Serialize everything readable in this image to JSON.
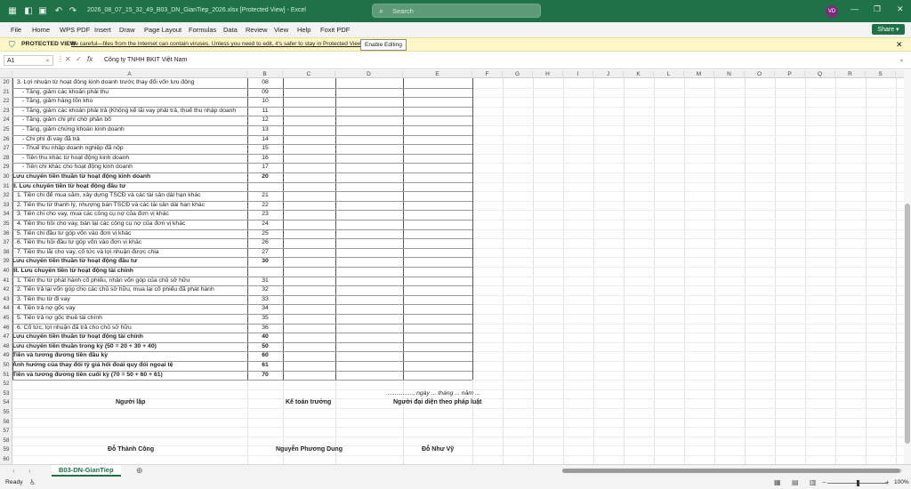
{
  "titlebar": {
    "autosave_icon": "autosave-icon",
    "save_icon": "save-icon",
    "undo_icon": "undo-icon",
    "redo_icon": "redo-icon",
    "title": "2026_08_07_15_32_49_B03_DN_GianTiep_2026.xlsx  [Protected View]  -  Excel",
    "search_placeholder": "Search",
    "avatar_initials": "VD",
    "accent_color": "#1f7246"
  },
  "ribbon": {
    "tabs": [
      "File",
      "Home",
      "WPS PDF",
      "Insert",
      "Draw",
      "Page Layout",
      "Formulas",
      "Data",
      "Review",
      "View",
      "Help",
      "Foxit PDF"
    ],
    "share_label": "Share"
  },
  "protected_view": {
    "label": "PROTECTED VIEW",
    "message": "Be careful—files from the Internet can contain viruses. Unless you need to edit, it's safer to stay in Protected View.",
    "enable_button": "Enable Editing"
  },
  "formula_bar": {
    "name_box": "A1",
    "fx_label": "fx",
    "value": "Công ty TNHH BKIT Việt Nam"
  },
  "columns": [
    "A",
    "B",
    "C",
    "D",
    "E",
    "F",
    "G",
    "H",
    "I",
    "J",
    "K",
    "L",
    "M",
    "N",
    "O",
    "P",
    "Q",
    "R",
    "S"
  ],
  "rows": [
    {
      "n": "20",
      "a": "   3. Lợi nhuận từ hoạt động kinh doanh trước thay đổi vốn lưu động",
      "b": "08",
      "style": "ind1"
    },
    {
      "n": "21",
      "a": "- Tăng, giảm các khoản phải thu",
      "b": "09",
      "style": "ind2"
    },
    {
      "n": "22",
      "a": "- Tăng, giảm hàng tồn kho",
      "b": "10",
      "style": "ind2"
    },
    {
      "n": "23",
      "a": "- Tăng, giảm các khoản phải trả (Không kể lãi vay phải trả, thuế thu nhập doanh",
      "b": "11",
      "style": "ind2"
    },
    {
      "n": "24",
      "a": "- Tăng, giảm chi phí chờ phân bổ",
      "b": "12",
      "style": "ind2"
    },
    {
      "n": "25",
      "a": "- Tăng, giảm chứng khoán kinh doanh",
      "b": "13",
      "style": "ind2"
    },
    {
      "n": "26",
      "a": "- Chi phí đi vay đã trả",
      "b": "14",
      "style": "ind2"
    },
    {
      "n": "27",
      "a": "- Thuế thu nhập doanh nghiệp đã nộp",
      "b": "15",
      "style": "ind2"
    },
    {
      "n": "28",
      "a": "- Tiền thu khác từ hoạt động kinh doanh",
      "b": "16",
      "style": "ind2"
    },
    {
      "n": "29",
      "a": "- Tiền chi khác cho hoạt động kinh doanh",
      "b": "17",
      "style": "ind2"
    },
    {
      "n": "30",
      "a": "Lưu chuyển tiền thuần từ hoạt động kinh doanh",
      "b": "20",
      "style": "bold"
    },
    {
      "n": "31",
      "a": "II. Lưu chuyển tiền từ hoạt động đầu tư",
      "b": "",
      "style": "bold"
    },
    {
      "n": "32",
      "a": "1. Tiền chi để mua sắm, xây dựng TSCĐ và các tài sản dài hạn khác",
      "b": "21",
      "style": "ind1"
    },
    {
      "n": "33",
      "a": "2. Tiền thu từ thanh lý, nhượng bán TSCĐ và các tài sản dài hạn khác",
      "b": "22",
      "style": "ind1"
    },
    {
      "n": "34",
      "a": "3. Tiền chi cho vay, mua các công cụ nợ của đơn vị khác",
      "b": "23",
      "style": "ind1"
    },
    {
      "n": "35",
      "a": "4. Tiền thu hồi cho vay, bán lại các công cụ nợ của đơn vị khác",
      "b": "24",
      "style": "ind1"
    },
    {
      "n": "36",
      "a": "5. Tiền chi đầu tư góp vốn vào đơn vị khác",
      "b": "25",
      "style": "ind1"
    },
    {
      "n": "37",
      "a": "6. Tiền thu hồi đầu tư góp vốn vào đơn vị khác",
      "b": "26",
      "style": "ind1"
    },
    {
      "n": "38",
      "a": "7. Tiền thu lãi cho vay, cổ tức và lợi nhuận được chia",
      "b": "27",
      "style": "ind1"
    },
    {
      "n": "39",
      "a": "Lưu chuyển tiền thuần từ hoạt động đầu tư",
      "b": "30",
      "style": "bold"
    },
    {
      "n": "40",
      "a": "III. Lưu chuyển tiền từ hoạt động tài chính",
      "b": "",
      "style": "bold"
    },
    {
      "n": "41",
      "a": "1. Tiền thu từ phát hành cổ phiếu, nhận vốn góp của chủ sở hữu",
      "b": "31",
      "style": "ind1"
    },
    {
      "n": "42",
      "a": "2. Tiền trả lại vốn góp cho các chủ sở hữu, mua lại cổ phiếu đã phát hành",
      "b": "32",
      "style": "ind1"
    },
    {
      "n": "43",
      "a": "3. Tiền thu từ đi vay",
      "b": "33",
      "style": "ind1"
    },
    {
      "n": "44",
      "a": "4. Tiền trả nợ gốc vay",
      "b": "34",
      "style": "ind1"
    },
    {
      "n": "45",
      "a": "5. Tiền trả nợ gốc thuê tài chính",
      "b": "35",
      "style": "ind1"
    },
    {
      "n": "46",
      "a": "6. Cổ tức, lợi nhuận đã trả cho chủ sở hữu",
      "b": "36",
      "style": "ind1"
    },
    {
      "n": "47",
      "a": "Lưu chuyển tiền thuần từ hoạt động tài chính",
      "b": "40",
      "style": "bold"
    },
    {
      "n": "48",
      "a": "Lưu chuyển tiền thuần trong kỳ (50 = 20 + 30 + 40)",
      "b": "50",
      "style": "bold"
    },
    {
      "n": "49",
      "a": "Tiền và tương đương tiền đầu kỳ",
      "b": "60",
      "style": "bold"
    },
    {
      "n": "50",
      "a": "Ảnh hưởng của thay đổi tỷ giá hối đoái quy đổi ngoại tệ",
      "b": "61",
      "style": "bold"
    },
    {
      "n": "51",
      "a": "Tiền và tương đương tiền cuối kỳ (70 = 50 + 60 + 61)",
      "b": "70",
      "style": "bold"
    },
    {
      "n": "52",
      "a": "",
      "b": "",
      "style": ""
    },
    {
      "n": "53",
      "a": "",
      "b": "",
      "style": ""
    },
    {
      "n": "54",
      "a": "",
      "b": "",
      "style": ""
    },
    {
      "n": "55",
      "a": "",
      "b": "",
      "style": ""
    },
    {
      "n": "56",
      "a": "",
      "b": "",
      "style": ""
    },
    {
      "n": "57",
      "a": "",
      "b": "",
      "style": ""
    },
    {
      "n": "58",
      "a": "",
      "b": "",
      "style": ""
    },
    {
      "n": "59",
      "a": "",
      "b": "",
      "style": ""
    },
    {
      "n": "60",
      "a": "",
      "b": "",
      "style": ""
    }
  ],
  "signatures": {
    "date_line": "..............., ngày ... tháng ... năm ...",
    "preparer_title": "Người lập",
    "accountant_title": "Kế toán trưởng",
    "director_title": "Người đại diện theo pháp luật",
    "preparer_name": "Đỗ Thành Công",
    "accountant_name": "Nguyễn Phương Dung",
    "director_name": "Đỗ Như Vỹ"
  },
  "sheet_tabs": {
    "active": "B03-DN-GianTiep",
    "add_icon": "plus-icon"
  },
  "status": {
    "ready": "Ready",
    "zoom": "100%"
  }
}
